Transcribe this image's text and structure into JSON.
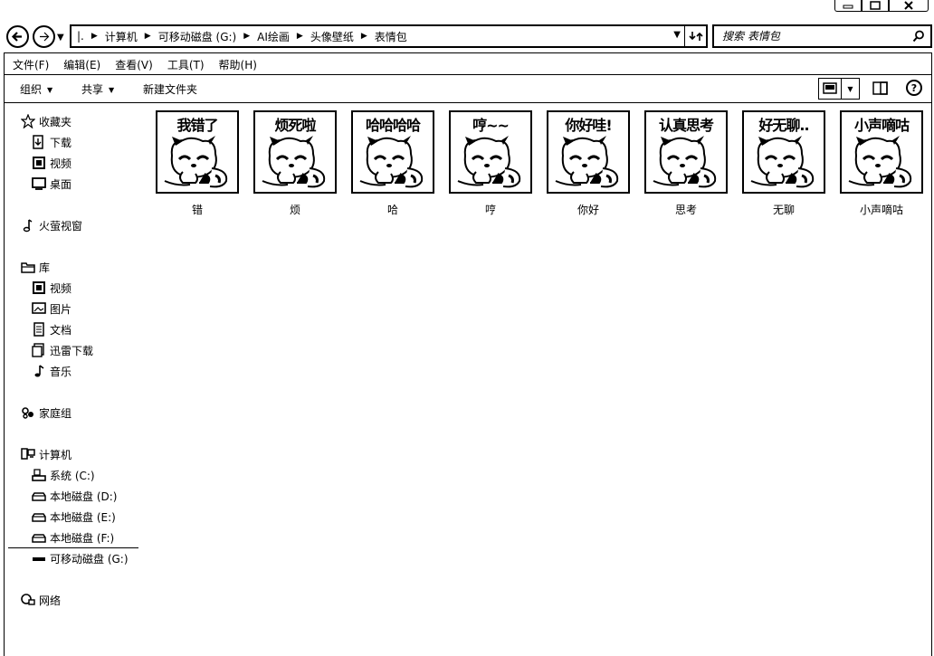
{
  "address": {
    "root_glyph": "|.",
    "crumbs": [
      "计算机",
      "可移动磁盘 (G:)",
      "AI绘画",
      "头像壁纸",
      "表情包"
    ]
  },
  "search": {
    "placeholder": "搜索 表情包"
  },
  "menu": [
    "文件(F)",
    "编辑(E)",
    "查看(V)",
    "工具(T)",
    "帮助(H)"
  ],
  "toolbar": {
    "organize": "组织",
    "share": "共享",
    "new_folder": "新建文件夹",
    "help": "?"
  },
  "nav": {
    "favorites": {
      "label": "收藏夹",
      "items": [
        "下载",
        "视频",
        "桌面"
      ]
    },
    "fire_video": "火萤视窗",
    "libraries": {
      "label": "库",
      "items": [
        "视频",
        "图片",
        "文档",
        "迅雷下载",
        "音乐"
      ]
    },
    "homegroup": "家庭组",
    "computer": {
      "label": "计算机",
      "items": [
        "系统 (C:)",
        "本地磁盘 (D:)",
        "本地磁盘 (E:)",
        "本地磁盘 (F:)",
        "可移动磁盘 (G:)"
      ]
    },
    "network": "网络"
  },
  "files": [
    {
      "name": "错",
      "caption": "我错了"
    },
    {
      "name": "烦",
      "caption": "烦死啦"
    },
    {
      "name": "哈",
      "caption": "哈哈哈哈"
    },
    {
      "name": "哼",
      "caption": "哼~~"
    },
    {
      "name": "你好",
      "caption": "你好哇!"
    },
    {
      "name": "思考",
      "caption": "认真思考"
    },
    {
      "name": "无聊",
      "caption": "好无聊.."
    },
    {
      "name": "小声嘀咕",
      "caption": "小声嘀咕"
    }
  ],
  "colors": {
    "ink": "#000000",
    "paper": "#ffffff"
  }
}
